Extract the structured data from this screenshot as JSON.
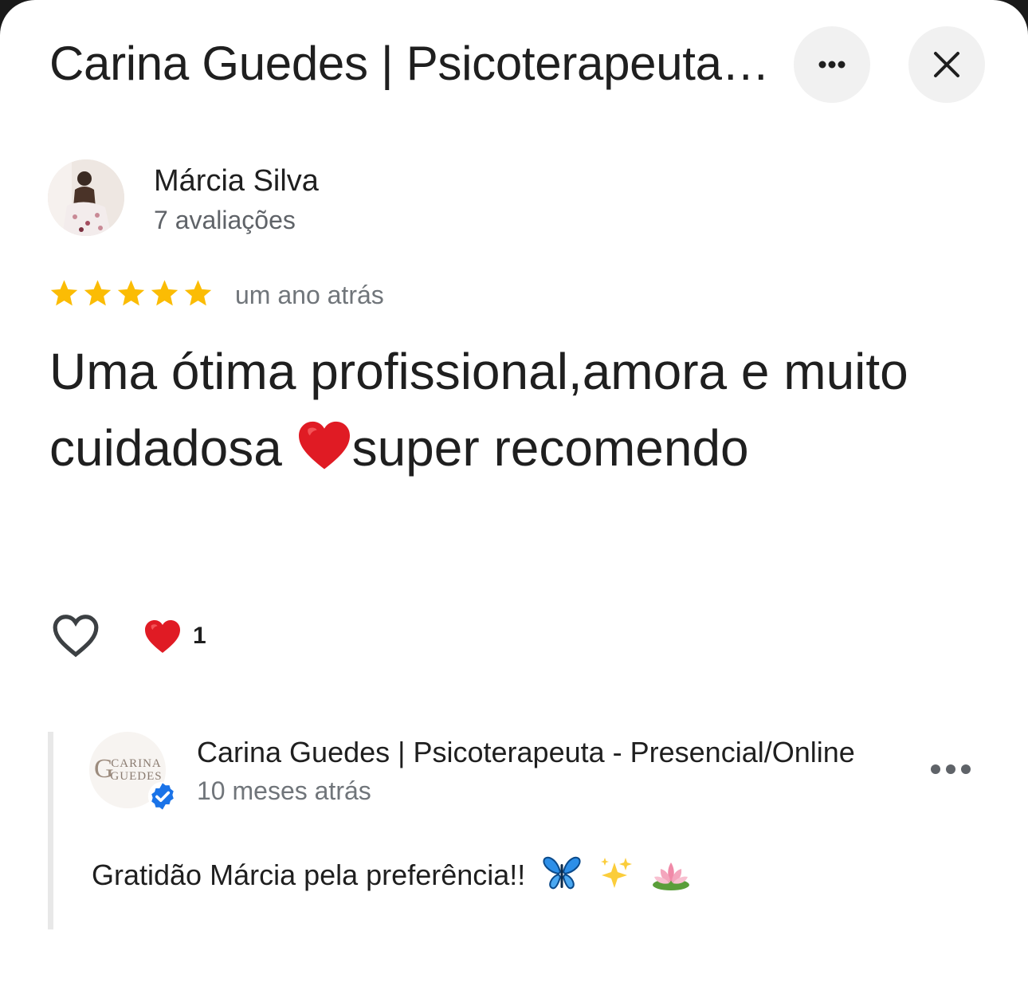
{
  "header": {
    "title": "Carina Guedes | Psicoterapeuta - Presencial/Online",
    "more_icon": "more-horiz-icon",
    "close_icon": "close-icon"
  },
  "review": {
    "reviewer_name": "Márcia Silva",
    "reviewer_review_count": "7 avaliações",
    "rating": 5,
    "rating_max": 5,
    "date": "um ano atrás",
    "text_part1": "Uma ótima profissional,amora e muito cuidadosa ",
    "text_part2": "super recomendo",
    "like_icon": "heart-outline-icon",
    "reactions": [
      {
        "icon": "red-heart-icon",
        "count": "1"
      }
    ]
  },
  "owner_reply": {
    "name": "Carina Guedes | Psicoterapeuta - Presencial/Online",
    "avatar_line1": "CARINA",
    "avatar_line2": "GUEDES",
    "avatar_monogram": "G",
    "verified_icon": "verified-badge-icon",
    "date": "10 meses atrás",
    "text": "Gratidão Márcia pela preferência!!",
    "emojis": [
      "butterfly-icon",
      "sparkles-icon",
      "lotus-icon"
    ]
  },
  "colors": {
    "star": "#fbbc04",
    "verified": "#1a73e8",
    "heart": "#e01b24"
  }
}
